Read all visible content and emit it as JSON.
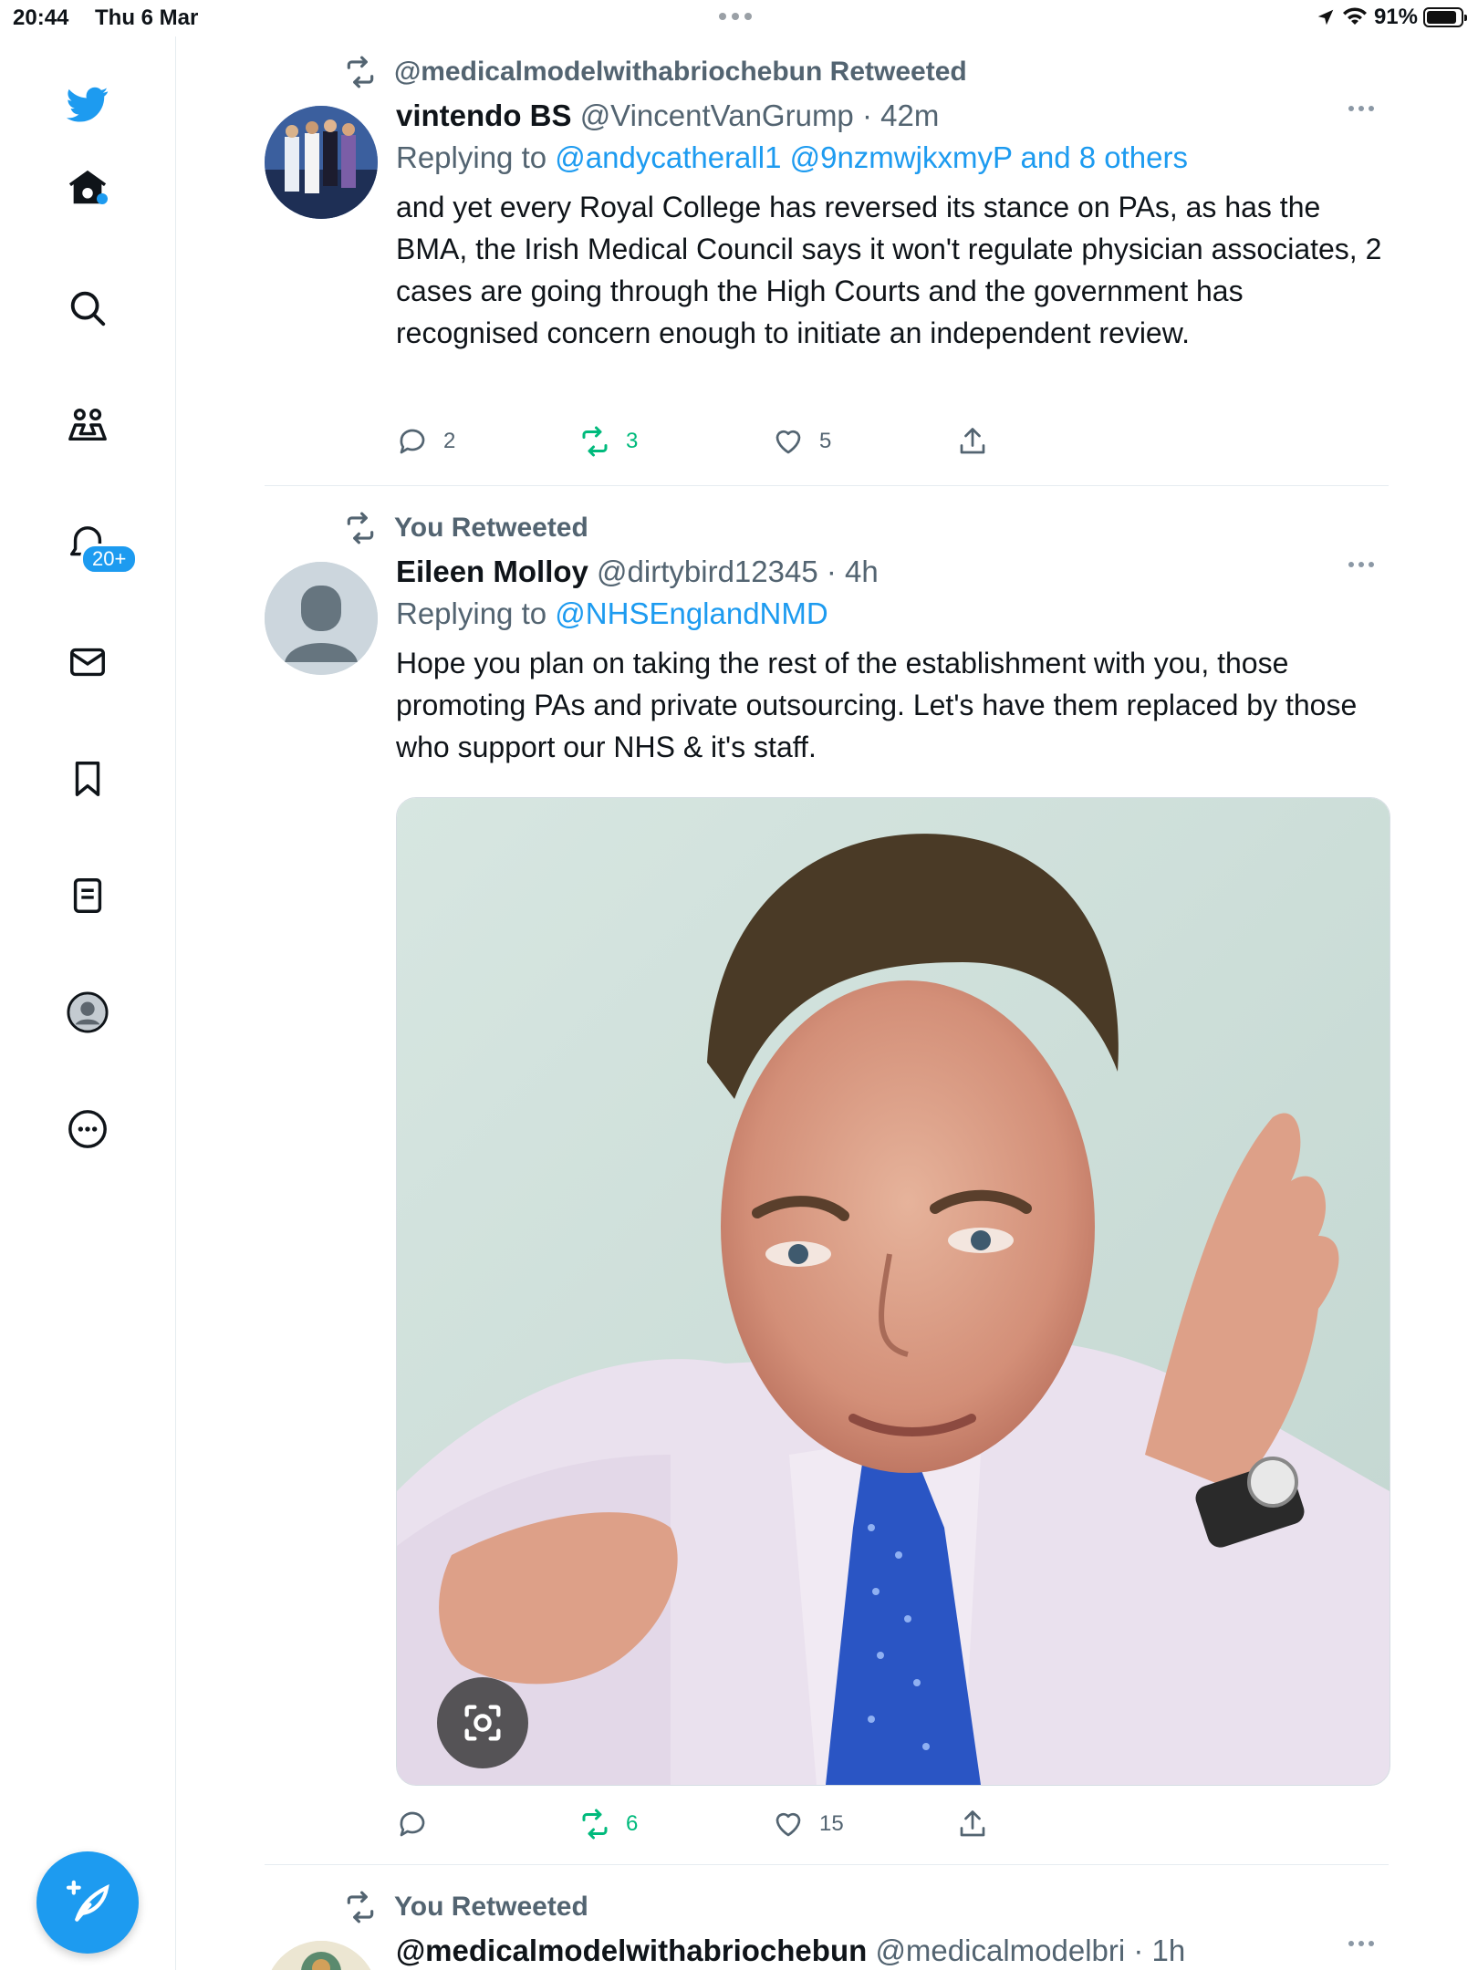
{
  "status_bar": {
    "time": "20:44",
    "date": "Thu 6 Mar",
    "battery": "91%",
    "battery_level": 0.91
  },
  "sidebar": {
    "items": [
      {
        "icon": "twitter-bird-icon"
      },
      {
        "icon": "home-icon"
      },
      {
        "icon": "search-icon"
      },
      {
        "icon": "communities-icon"
      },
      {
        "icon": "notifications-bell-icon"
      },
      {
        "icon": "messages-icon"
      },
      {
        "icon": "bookmarks-icon"
      },
      {
        "icon": "lists-icon"
      },
      {
        "icon": "profile-icon"
      },
      {
        "icon": "more-icon"
      }
    ],
    "notifications_badge": "20+",
    "compose_icon": "compose-tweet-icon"
  },
  "tweets": [
    {
      "retweet_label": "@medicalmodelwithabriochebun Retweeted",
      "name": "vintendo BS",
      "handle": "@VincentVanGrump",
      "time": "· 42m",
      "replying_prefix": "Replying to",
      "replying_to": "@andycatherall1 @9nzmwjkxmyP and 8 others",
      "text": "and yet every Royal College has reversed its stance on PAs, as has the BMA, the Irish Medical Council says it won't regulate physician associates, 2 cases are going through the High Courts and the government has recognised concern enough to initiate an independent review.",
      "replies": "2",
      "retweets": "3",
      "likes": "5"
    },
    {
      "retweet_label": "You Retweeted",
      "name": "Eileen Molloy",
      "handle": "@dirtybird12345",
      "time": "· 4h",
      "replying_prefix": "Replying to",
      "replying_to": "@NHSEnglandNMD",
      "text": "Hope you plan on taking the rest of the establishment with you, those promoting PAs and private outsourcing. Let's have them replaced by those who support our NHS & it's staff.",
      "replies": "",
      "retweets": "6",
      "likes": "15"
    },
    {
      "retweet_label": "You Retweeted",
      "name": "@medicalmodelwithabriochebun",
      "handle": "@medicalmodelbri",
      "time": "· 1h"
    }
  ],
  "colors": {
    "accent": "#1d9bf0",
    "retweet_green": "#00ba7c",
    "muted": "#536471"
  }
}
